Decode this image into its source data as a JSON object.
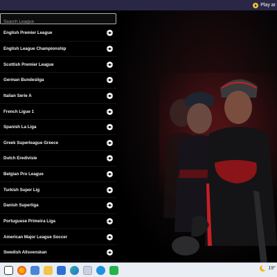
{
  "topbar": {
    "play_label": "Play ar"
  },
  "search": {
    "placeholder": "Search League"
  },
  "leagues": [
    {
      "label": "English Premier League"
    },
    {
      "label": "English League Championship"
    },
    {
      "label": "Scottish Premier League"
    },
    {
      "label": "German Bundesliga"
    },
    {
      "label": "Italian Serie A"
    },
    {
      "label": "French Ligue 1"
    },
    {
      "label": "Spanish La Liga"
    },
    {
      "label": "Greek Superleague Greece"
    },
    {
      "label": "Dutch Eredivisie"
    },
    {
      "label": "Belgian Pro League"
    },
    {
      "label": "Turkish Super Lig"
    },
    {
      "label": "Danish Superliga"
    },
    {
      "label": "Portuguese Primeira Liga"
    },
    {
      "label": "American Major League Soccer"
    },
    {
      "label": "Swedish Allsvenskan"
    }
  ],
  "taskbar": {
    "icons": [
      "task-view-icon",
      "firefox-icon",
      "file-explorer-icon",
      "folder-icon",
      "mail-icon",
      "edge-icon",
      "app-icon",
      "browser-icon",
      "terminal-icon"
    ],
    "tray_temp": "19°"
  },
  "colors": {
    "topbar": "#2a2746",
    "background": "#000000",
    "accent_red": "#d62828",
    "taskbar": "#e9eef5"
  }
}
